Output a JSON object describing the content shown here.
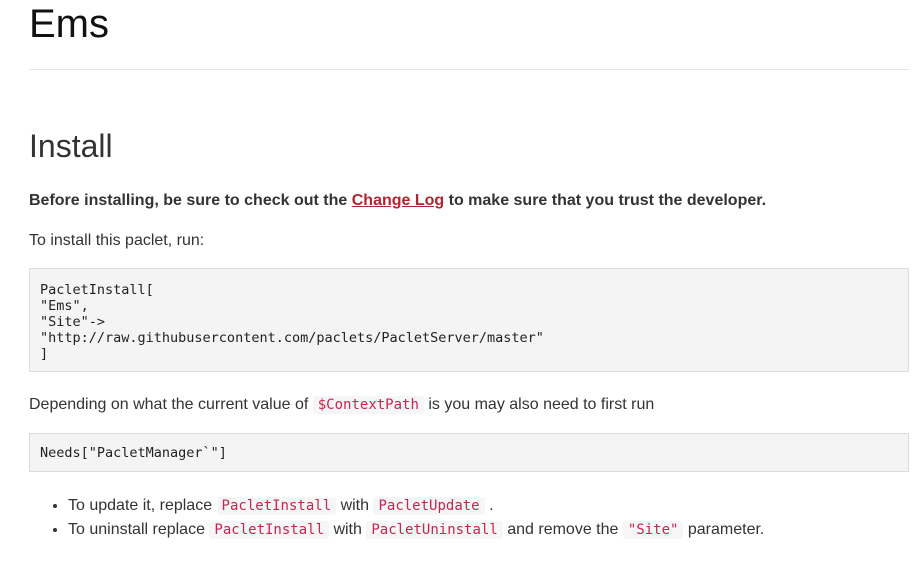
{
  "header": {
    "title": "Ems"
  },
  "install": {
    "heading": "Install",
    "warning": {
      "before": "Before installing, be sure to check out the ",
      "link_label": "Change Log",
      "after": " to make sure that you trust the developer."
    },
    "intro": "To install this paclet, run:",
    "install_code": "PacletInstall[\n\"Ems\",\n\"Site\"->\n\"http://raw.githubusercontent.com/paclets/PacletServer/master\"\n]",
    "depend": {
      "before": "Depending on what the current value of ",
      "code": "$ContextPath",
      "after": " is you may also need to first run"
    },
    "needs_code": "Needs[\"PacletManager`\"]",
    "notes": [
      {
        "t1": "To update it, replace ",
        "c1": "PacletInstall",
        "t2": " with ",
        "c2": "PacletUpdate",
        "t3": " ."
      },
      {
        "t1": "To uninstall replace ",
        "c1": "PacletInstall",
        "t2": " with ",
        "c2": "PacletUninstall",
        "t3": " and remove the ",
        "c3": "\"Site\"",
        "t4": " parameter."
      }
    ]
  },
  "colors": {
    "link": "#b0262f",
    "inline_code": "#c7254e",
    "code_background": "#f4f4f4",
    "text": "#333333"
  }
}
